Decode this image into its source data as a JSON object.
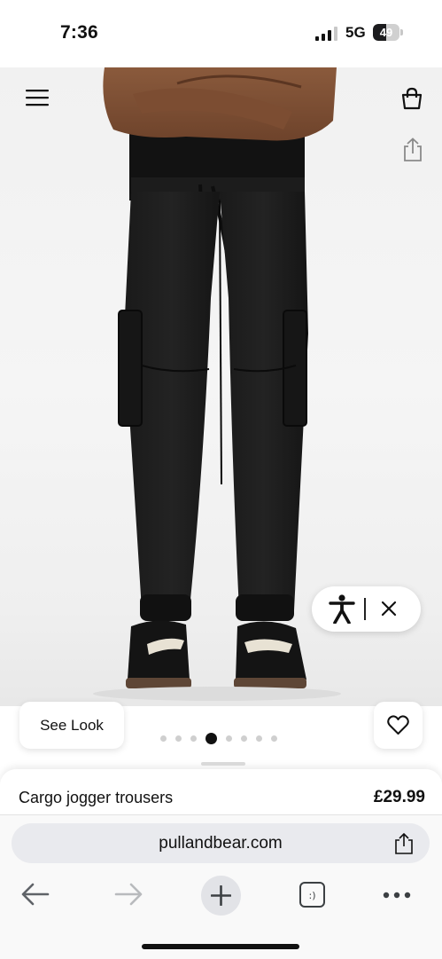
{
  "status_bar": {
    "time": "7:36",
    "network": "5G",
    "battery": "49",
    "battery_level": 0.49
  },
  "header": {
    "menu_icon": "hamburger-menu-icon",
    "bag_icon": "shopping-bag-icon",
    "share_icon": "share-icon"
  },
  "hero": {
    "accessibility_icon": "accessibility-person-icon",
    "close_icon": "close-icon"
  },
  "gallery": {
    "see_look_label": "See Look",
    "favorite_icon": "heart-icon",
    "dots_count": 8,
    "active_index": 3
  },
  "product": {
    "name": "Cargo jogger trousers",
    "price": "£29.99"
  },
  "browser": {
    "url": "pullandbear.com",
    "share_icon": "share-icon",
    "toolbar": [
      "back-arrow-icon",
      "forward-arrow-icon",
      "plus-icon",
      "tabs-icon",
      "more-icon"
    ]
  },
  "colors": {
    "text": "#111111",
    "url_bar": "#e9eaee",
    "hero_bg": "#f2f2f2"
  }
}
